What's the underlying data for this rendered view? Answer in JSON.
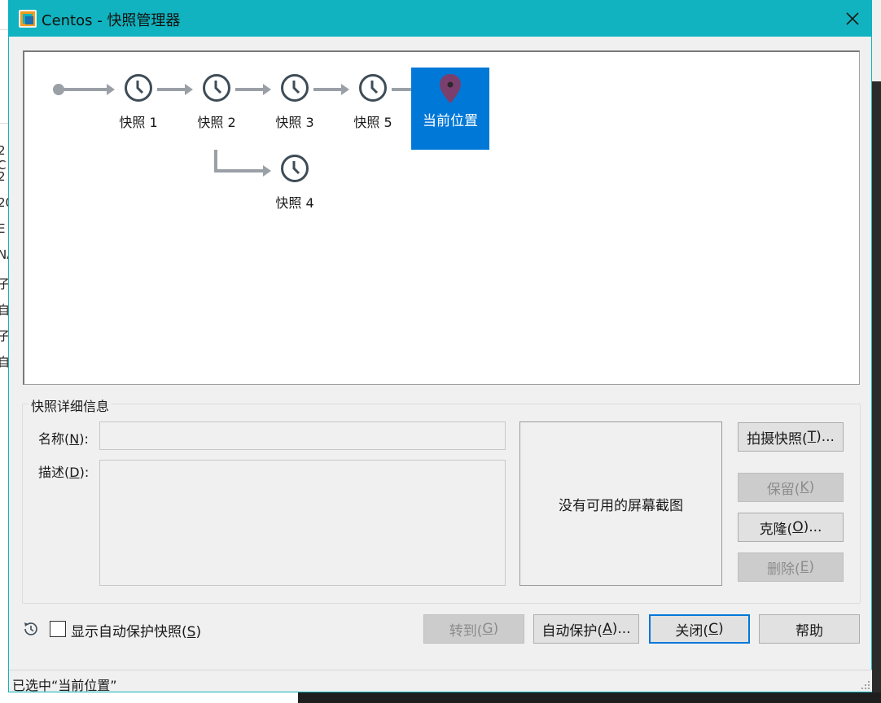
{
  "window": {
    "title": "Centos - 快照管理器"
  },
  "tree": {
    "snapshots": [
      {
        "label": "快照 1"
      },
      {
        "label": "快照 2"
      },
      {
        "label": "快照 3"
      },
      {
        "label": "快照 5"
      },
      {
        "label": "快照 4"
      }
    ],
    "current_label": "当前位置"
  },
  "details": {
    "group_title": "快照详细信息",
    "name_label_prefix": "名称(",
    "name_mnemonic": "N",
    "name_label_suffix": "):",
    "name_value": "",
    "desc_label_prefix": "描述(",
    "desc_mnemonic": "D",
    "desc_label_suffix": "):",
    "desc_value": "",
    "screenshot_placeholder": "没有可用的屏幕截图"
  },
  "side_buttons": {
    "take_prefix": "拍摄快照(",
    "take_key": "T",
    "take_suffix": ")...",
    "keep_prefix": "保留(",
    "keep_key": "K",
    "keep_suffix": ")",
    "clone_prefix": "克隆(",
    "clone_key": "O",
    "clone_suffix": ")...",
    "delete_prefix": "删除(",
    "delete_key": "E",
    "delete_suffix": ")"
  },
  "footer": {
    "show_auto_prefix": "显示自动保护快照(",
    "show_auto_key": "S",
    "show_auto_suffix": ")",
    "goto_prefix": "转到(",
    "goto_key": "G",
    "goto_suffix": ")",
    "autoprotect_prefix": "自动保护(",
    "autoprotect_key": "A",
    "autoprotect_suffix": ")...",
    "close_prefix": "关闭(",
    "close_key": "C",
    "close_suffix": ")",
    "help_label": "帮助"
  },
  "status": {
    "text": "已选中“当前位置”"
  },
  "background": {
    "fragments": [
      "2 C",
      "2",
      "20",
      "E",
      "NA",
      "子",
      "自",
      "子",
      "自"
    ]
  },
  "colors": {
    "titlebar": "#10b3bf",
    "selection": "#0078d7",
    "node_icon": "#3e4c57",
    "arrow": "#9aa0a6",
    "pin": "#7b3f6e"
  }
}
